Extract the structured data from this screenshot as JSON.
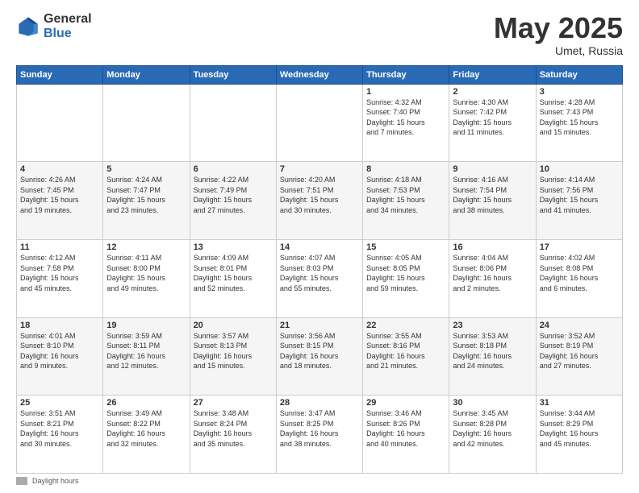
{
  "logo": {
    "general": "General",
    "blue": "Blue"
  },
  "title": {
    "month_year": "May 2025",
    "location": "Umet, Russia"
  },
  "header_days": [
    "Sunday",
    "Monday",
    "Tuesday",
    "Wednesday",
    "Thursday",
    "Friday",
    "Saturday"
  ],
  "weeks": [
    [
      {
        "day": "",
        "info": ""
      },
      {
        "day": "",
        "info": ""
      },
      {
        "day": "",
        "info": ""
      },
      {
        "day": "",
        "info": ""
      },
      {
        "day": "1",
        "info": "Sunrise: 4:32 AM\nSunset: 7:40 PM\nDaylight: 15 hours\nand 7 minutes."
      },
      {
        "day": "2",
        "info": "Sunrise: 4:30 AM\nSunset: 7:42 PM\nDaylight: 15 hours\nand 11 minutes."
      },
      {
        "day": "3",
        "info": "Sunrise: 4:28 AM\nSunset: 7:43 PM\nDaylight: 15 hours\nand 15 minutes."
      }
    ],
    [
      {
        "day": "4",
        "info": "Sunrise: 4:26 AM\nSunset: 7:45 PM\nDaylight: 15 hours\nand 19 minutes."
      },
      {
        "day": "5",
        "info": "Sunrise: 4:24 AM\nSunset: 7:47 PM\nDaylight: 15 hours\nand 23 minutes."
      },
      {
        "day": "6",
        "info": "Sunrise: 4:22 AM\nSunset: 7:49 PM\nDaylight: 15 hours\nand 27 minutes."
      },
      {
        "day": "7",
        "info": "Sunrise: 4:20 AM\nSunset: 7:51 PM\nDaylight: 15 hours\nand 30 minutes."
      },
      {
        "day": "8",
        "info": "Sunrise: 4:18 AM\nSunset: 7:53 PM\nDaylight: 15 hours\nand 34 minutes."
      },
      {
        "day": "9",
        "info": "Sunrise: 4:16 AM\nSunset: 7:54 PM\nDaylight: 15 hours\nand 38 minutes."
      },
      {
        "day": "10",
        "info": "Sunrise: 4:14 AM\nSunset: 7:56 PM\nDaylight: 15 hours\nand 41 minutes."
      }
    ],
    [
      {
        "day": "11",
        "info": "Sunrise: 4:12 AM\nSunset: 7:58 PM\nDaylight: 15 hours\nand 45 minutes."
      },
      {
        "day": "12",
        "info": "Sunrise: 4:11 AM\nSunset: 8:00 PM\nDaylight: 15 hours\nand 49 minutes."
      },
      {
        "day": "13",
        "info": "Sunrise: 4:09 AM\nSunset: 8:01 PM\nDaylight: 15 hours\nand 52 minutes."
      },
      {
        "day": "14",
        "info": "Sunrise: 4:07 AM\nSunset: 8:03 PM\nDaylight: 15 hours\nand 55 minutes."
      },
      {
        "day": "15",
        "info": "Sunrise: 4:05 AM\nSunset: 8:05 PM\nDaylight: 15 hours\nand 59 minutes."
      },
      {
        "day": "16",
        "info": "Sunrise: 4:04 AM\nSunset: 8:06 PM\nDaylight: 16 hours\nand 2 minutes."
      },
      {
        "day": "17",
        "info": "Sunrise: 4:02 AM\nSunset: 8:08 PM\nDaylight: 16 hours\nand 6 minutes."
      }
    ],
    [
      {
        "day": "18",
        "info": "Sunrise: 4:01 AM\nSunset: 8:10 PM\nDaylight: 16 hours\nand 9 minutes."
      },
      {
        "day": "19",
        "info": "Sunrise: 3:59 AM\nSunset: 8:11 PM\nDaylight: 16 hours\nand 12 minutes."
      },
      {
        "day": "20",
        "info": "Sunrise: 3:57 AM\nSunset: 8:13 PM\nDaylight: 16 hours\nand 15 minutes."
      },
      {
        "day": "21",
        "info": "Sunrise: 3:56 AM\nSunset: 8:15 PM\nDaylight: 16 hours\nand 18 minutes."
      },
      {
        "day": "22",
        "info": "Sunrise: 3:55 AM\nSunset: 8:16 PM\nDaylight: 16 hours\nand 21 minutes."
      },
      {
        "day": "23",
        "info": "Sunrise: 3:53 AM\nSunset: 8:18 PM\nDaylight: 16 hours\nand 24 minutes."
      },
      {
        "day": "24",
        "info": "Sunrise: 3:52 AM\nSunset: 8:19 PM\nDaylight: 16 hours\nand 27 minutes."
      }
    ],
    [
      {
        "day": "25",
        "info": "Sunrise: 3:51 AM\nSunset: 8:21 PM\nDaylight: 16 hours\nand 30 minutes."
      },
      {
        "day": "26",
        "info": "Sunrise: 3:49 AM\nSunset: 8:22 PM\nDaylight: 16 hours\nand 32 minutes."
      },
      {
        "day": "27",
        "info": "Sunrise: 3:48 AM\nSunset: 8:24 PM\nDaylight: 16 hours\nand 35 minutes."
      },
      {
        "day": "28",
        "info": "Sunrise: 3:47 AM\nSunset: 8:25 PM\nDaylight: 16 hours\nand 38 minutes."
      },
      {
        "day": "29",
        "info": "Sunrise: 3:46 AM\nSunset: 8:26 PM\nDaylight: 16 hours\nand 40 minutes."
      },
      {
        "day": "30",
        "info": "Sunrise: 3:45 AM\nSunset: 8:28 PM\nDaylight: 16 hours\nand 42 minutes."
      },
      {
        "day": "31",
        "info": "Sunrise: 3:44 AM\nSunset: 8:29 PM\nDaylight: 16 hours\nand 45 minutes."
      }
    ]
  ],
  "footer": {
    "swatch_label": "Daylight hours"
  }
}
